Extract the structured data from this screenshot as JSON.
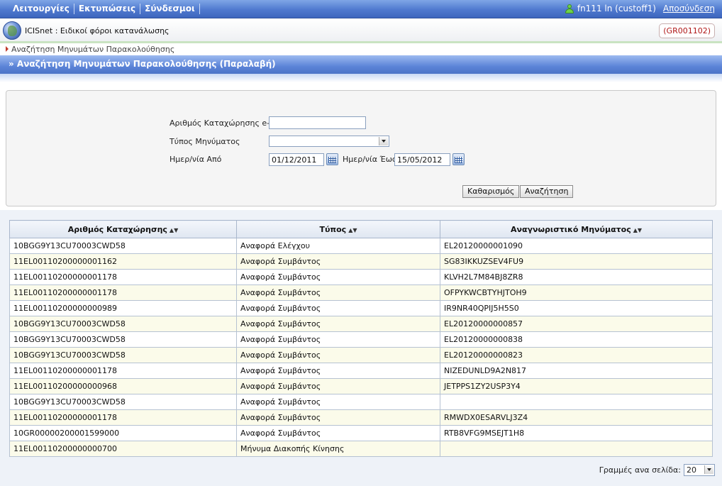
{
  "topbar": {
    "menu": [
      "Λειτουργίες",
      "Εκτυπώσεις",
      "Σύνδεσμοι"
    ],
    "user": "fn111 ln (custoff1)",
    "logout": "Αποσύνδεση"
  },
  "app": {
    "title": "ICISnet : Ειδικοί φόροι κατανάλωσης",
    "code": "(GR001102)"
  },
  "breadcrumb": "Αναζήτηση Μηνυμάτων Παρακολούθησης",
  "page_title": "» Αναζήτηση Μηνυμάτων Παρακολούθησης (Παραλαβή)",
  "form": {
    "reg_label": "Αριθμός Καταχώρησης e-ΔΕ",
    "reg_value": "",
    "type_label": "Τύπος Μηνύματος",
    "type_value": "",
    "date_from_label": "Ημερ/νία Από",
    "date_from": "01/12/2011",
    "date_to_label": "Ημερ/νία Έως",
    "date_to": "15/05/2012",
    "clear_label": "Καθαρισμός",
    "search_label": "Αναζήτηση"
  },
  "table": {
    "headers": [
      "Αριθμός Καταχώρησης",
      "Τύπος",
      "Αναγνωριστικό Μηνύματος"
    ],
    "rows": [
      [
        "10BGG9Y13CU70003CWD58",
        "Αναφορά Ελέγχου",
        "EL20120000001090"
      ],
      [
        "11EL00110200000001162",
        "Αναφορά Συμβάντος",
        "SG83IKKUZSEV4FU9"
      ],
      [
        "11EL00110200000001178",
        "Αναφορά Συμβάντος",
        "KLVH2L7M84BJ8ZR8"
      ],
      [
        "11EL00110200000001178",
        "Αναφορά Συμβάντος",
        "OFPYKWCBTYHJTOH9"
      ],
      [
        "11EL00110200000000989",
        "Αναφορά Συμβάντος",
        "IR9NR40QPIJ5H5S0"
      ],
      [
        "10BGG9Y13CU70003CWD58",
        "Αναφορά Συμβάντος",
        "EL20120000000857"
      ],
      [
        "10BGG9Y13CU70003CWD58",
        "Αναφορά Συμβάντος",
        "EL20120000000838"
      ],
      [
        "10BGG9Y13CU70003CWD58",
        "Αναφορά Συμβάντος",
        "EL20120000000823"
      ],
      [
        "11EL00110200000001178",
        "Αναφορά Συμβάντος",
        "NIZEDUNLD9A2N817"
      ],
      [
        "11EL00110200000000968",
        "Αναφορά Συμβάντος",
        "JETPPS1ZY2USP3Y4"
      ],
      [
        "10BGG9Y13CU70003CWD58",
        "Αναφορά Συμβάντος",
        ""
      ],
      [
        "11EL00110200000001178",
        "Αναφορά Συμβάντος",
        "RMWDX0ESARVLJ3Z4"
      ],
      [
        "10GR00000200001599000",
        "Αναφορά Συμβάντος",
        "RTB8VFG9MSEJT1H8"
      ],
      [
        "11EL00110200000000700",
        "Μήνυμα Διακοπής Κίνησης",
        ""
      ]
    ]
  },
  "pager": {
    "label": "Γραμμές ανα σελίδα:",
    "value": "20"
  }
}
